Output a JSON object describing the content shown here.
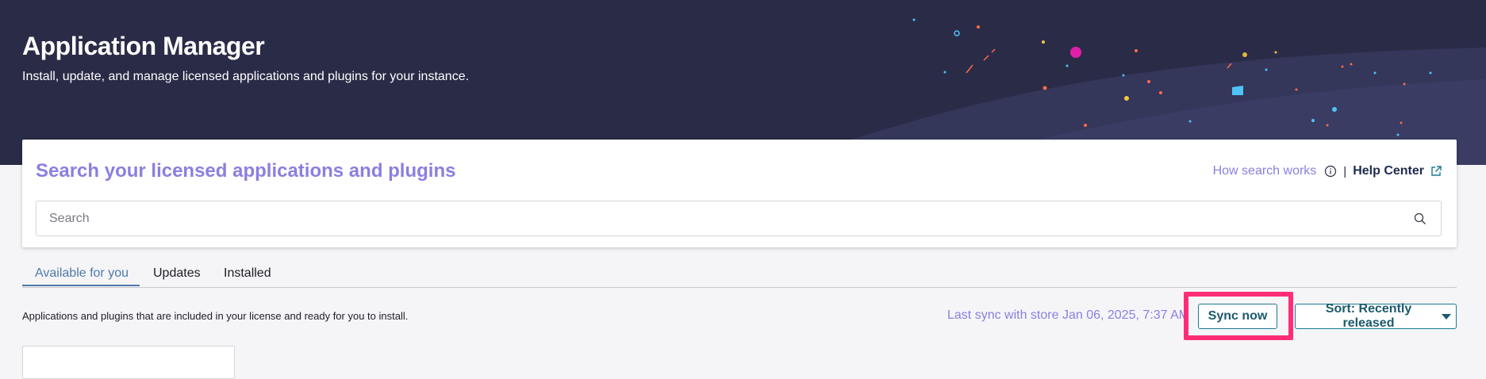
{
  "header": {
    "title": "Application Manager",
    "subtitle": "Install, update, and manage licensed applications and plugins for your instance."
  },
  "search_card": {
    "heading": "Search your licensed applications and plugins",
    "how_search_works": "How search works",
    "separator": "|",
    "help_center": "Help Center",
    "search_placeholder": "Search",
    "search_value": ""
  },
  "tabs": [
    {
      "label": "Available for you",
      "active": true
    },
    {
      "label": "Updates",
      "active": false
    },
    {
      "label": "Installed",
      "active": false
    }
  ],
  "toolbar": {
    "description": "Applications and plugins that are included in your license and ready for you to install.",
    "last_sync": "Last sync with store  Jan 06, 2025, 7:37 AM",
    "sync_button": "Sync now",
    "sort_button": "Sort: Recently released"
  },
  "colors": {
    "header_bg": "#2a2b47",
    "accent_purple": "#8a7fe0",
    "tab_active": "#4f79a8",
    "button_border": "#1c7a93",
    "highlight": "#ff2d78"
  },
  "icons": {
    "info": "info-circle-icon",
    "external": "external-link-icon",
    "search": "search-icon",
    "sort": "caret-down-icon"
  }
}
